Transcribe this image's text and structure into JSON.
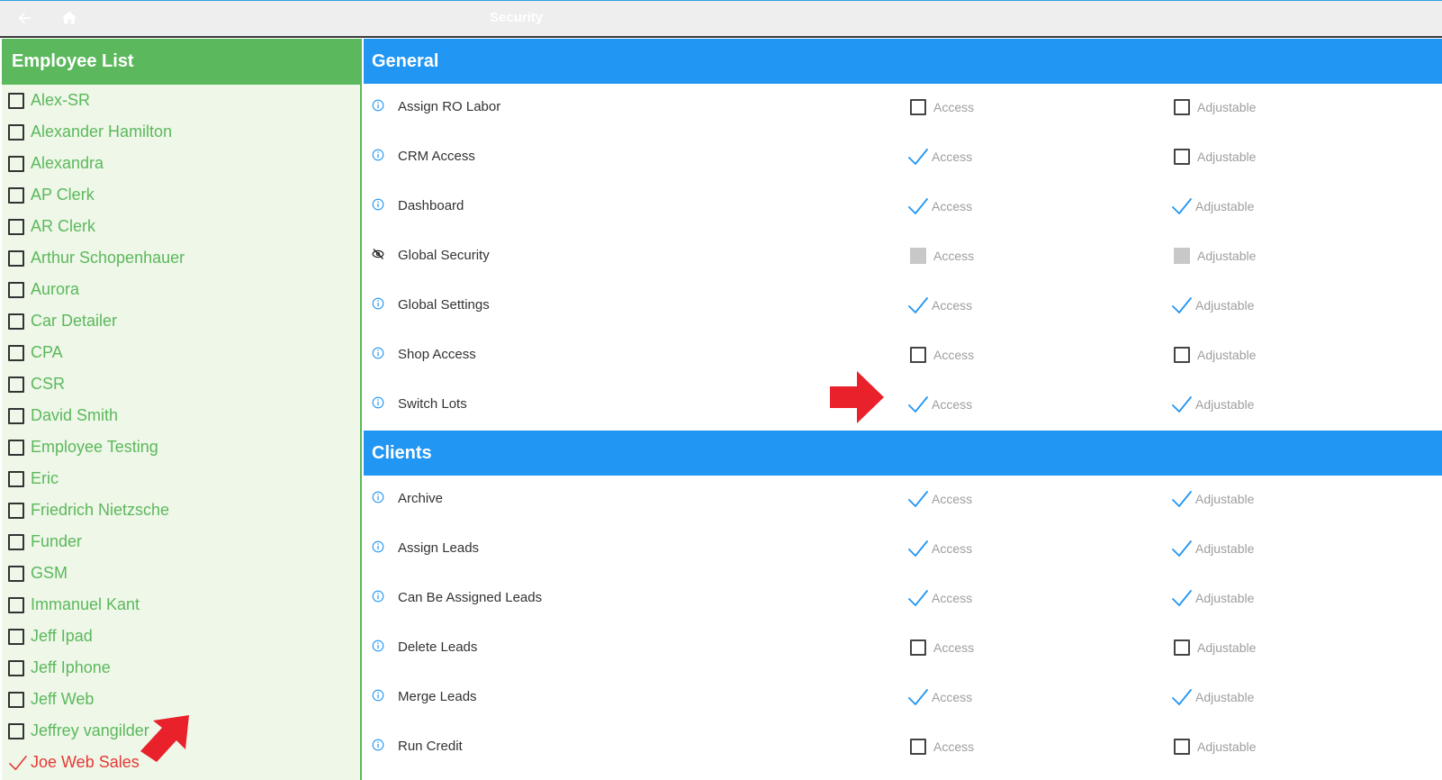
{
  "header": {
    "title": "Security"
  },
  "icons": {
    "back": "arrow-left-icon",
    "home": "home-icon",
    "info": "info-circle-icon",
    "hidden": "eye-off-icon",
    "check": "checkmark-icon"
  },
  "colors": {
    "green": "#5cb85c",
    "blue": "#2196f3",
    "red": "#e53935",
    "check": "#2196f3"
  },
  "sidebar": {
    "title": "Employee List",
    "employees": [
      {
        "name": "Alex-SR",
        "checked": false
      },
      {
        "name": "Alexander Hamilton",
        "checked": false
      },
      {
        "name": "Alexandra",
        "checked": false
      },
      {
        "name": "AP Clerk",
        "checked": false
      },
      {
        "name": "AR Clerk",
        "checked": false
      },
      {
        "name": "Arthur Schopenhauer",
        "checked": false
      },
      {
        "name": "Aurora",
        "checked": false
      },
      {
        "name": "Car Detailer",
        "checked": false
      },
      {
        "name": "CPA",
        "checked": false
      },
      {
        "name": "CSR",
        "checked": false
      },
      {
        "name": "David Smith",
        "checked": false
      },
      {
        "name": "Employee Testing",
        "checked": false
      },
      {
        "name": "Eric",
        "checked": false
      },
      {
        "name": "Friedrich Nietzsche",
        "checked": false
      },
      {
        "name": "Funder",
        "checked": false
      },
      {
        "name": "GSM",
        "checked": false
      },
      {
        "name": "Immanuel Kant",
        "checked": false
      },
      {
        "name": "Jeff Ipad",
        "checked": false
      },
      {
        "name": "Jeff Iphone",
        "checked": false
      },
      {
        "name": "Jeff Web",
        "checked": false
      },
      {
        "name": "Jeffrey vangilder",
        "checked": false
      },
      {
        "name": "Joe Web Sales",
        "checked": true
      }
    ]
  },
  "sections": [
    {
      "title": "General",
      "rows": [
        {
          "label": "Assign RO Labor",
          "icon": "info",
          "access": "unchecked",
          "adjustable": "unchecked"
        },
        {
          "label": "CRM Access",
          "icon": "info",
          "access": "checked",
          "adjustable": "unchecked"
        },
        {
          "label": "Dashboard",
          "icon": "info",
          "access": "checked",
          "adjustable": "checked"
        },
        {
          "label": "Global Security",
          "icon": "hidden",
          "access": "disabled",
          "adjustable": "disabled"
        },
        {
          "label": "Global Settings",
          "icon": "info",
          "access": "checked",
          "adjustable": "checked"
        },
        {
          "label": "Shop Access",
          "icon": "info",
          "access": "unchecked",
          "adjustable": "unchecked"
        },
        {
          "label": "Switch Lots",
          "icon": "info",
          "access": "checked",
          "adjustable": "checked"
        }
      ]
    },
    {
      "title": "Clients",
      "rows": [
        {
          "label": "Archive",
          "icon": "info",
          "access": "checked",
          "adjustable": "checked"
        },
        {
          "label": "Assign Leads",
          "icon": "info",
          "access": "checked",
          "adjustable": "checked"
        },
        {
          "label": "Can Be Assigned Leads",
          "icon": "info",
          "access": "checked",
          "adjustable": "checked"
        },
        {
          "label": "Delete Leads",
          "icon": "info",
          "access": "unchecked",
          "adjustable": "unchecked"
        },
        {
          "label": "Merge Leads",
          "icon": "info",
          "access": "checked",
          "adjustable": "checked"
        },
        {
          "label": "Run Credit",
          "icon": "info",
          "access": "unchecked",
          "adjustable": "unchecked"
        }
      ]
    }
  ],
  "labels": {
    "access": "Access",
    "adjustable": "Adjustable"
  }
}
